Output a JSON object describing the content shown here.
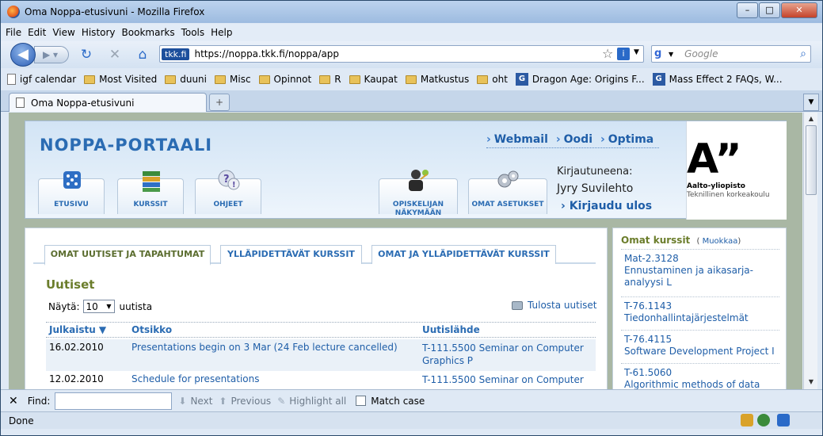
{
  "window": {
    "title": "Oma Noppa-etusivuni - Mozilla Firefox"
  },
  "menu": [
    "File",
    "Edit",
    "View",
    "History",
    "Bookmarks",
    "Tools",
    "Help"
  ],
  "nav": {
    "site_badge": "tkk.fi",
    "url": "https://noppa.tkk.fi/noppa/app",
    "search_placeholder": "Google"
  },
  "bookmarks": [
    {
      "label": "igf calendar",
      "icon": "page-icon"
    },
    {
      "label": "Most Visited",
      "icon": "folder-icon"
    },
    {
      "label": "duuni",
      "icon": "folder-icon"
    },
    {
      "label": "Misc",
      "icon": "folder-icon"
    },
    {
      "label": "Opinnot",
      "icon": "folder-icon"
    },
    {
      "label": "R",
      "icon": "folder-icon"
    },
    {
      "label": "Kaupat",
      "icon": "folder-icon"
    },
    {
      "label": "Matkustus",
      "icon": "folder-icon"
    },
    {
      "label": "oht",
      "icon": "folder-icon"
    },
    {
      "label": "Dragon Age: Origins F...",
      "icon": "gamefaqs-icon"
    },
    {
      "label": "Mass Effect 2 FAQs, W...",
      "icon": "gamefaqs-icon"
    }
  ],
  "tab": {
    "title": "Oma Noppa-etusivuni"
  },
  "portal": {
    "name": "NOPPA-PORTAALI",
    "nav_buttons": [
      {
        "label": "ETUSIVU",
        "icon": "dice-icon"
      },
      {
        "label": "KURSSIT",
        "icon": "books-icon"
      },
      {
        "label": "OHJEET",
        "icon": "help-icon"
      }
    ],
    "student_view": "OPISKELIJAN NÄKYMÄÄN",
    "own_settings": "OMAT ASETUKSET",
    "top_links": [
      "Webmail",
      "Oodi",
      "Optima"
    ],
    "logged_in_label": "Kirjautuneena:",
    "user_name": "Jyry Suvilehto",
    "logout": "Kirjaudu ulos",
    "logo_mark": "A”",
    "logo_line1": "Aalto-yliopisto",
    "logo_line2": "Teknillinen korkeakoulu"
  },
  "content_tabs": [
    "OMAT UUTISET JA TAPAHTUMAT",
    "YLLÄPIDETTÄVÄT KURSSIT",
    "OMAT JA YLLÄPIDETTÄVÄT KURSSIT"
  ],
  "news": {
    "title": "Uutiset",
    "show_label": "Näytä:",
    "show_value": "10",
    "show_suffix": "uutista",
    "print_label": "Tulosta uutiset",
    "columns": [
      "Julkaistu ▼",
      "Otsikko",
      "Uutislähde"
    ],
    "rows": [
      {
        "date": "16.02.2010",
        "title": "Presentations begin on 3 Mar (24 Feb lecture cancelled)",
        "source": "T-111.5500 Seminar on Computer Graphics P"
      },
      {
        "date": "12.02.2010",
        "title": "Schedule for presentations",
        "source": "T-111.5500 Seminar on Computer"
      }
    ]
  },
  "my_courses": {
    "title": "Omat kurssit",
    "edit_open": "(",
    "edit": "Muokkaa",
    "edit_close": ")",
    "items": [
      {
        "code": "Mat-2.3128",
        "name": "Ennustaminen ja aikasarja-analyysi L"
      },
      {
        "code": "T-76.1143",
        "name": "Tiedonhallintajärjestelmät"
      },
      {
        "code": "T-76.4115",
        "name": "Software Development Project I"
      },
      {
        "code": "T-61.5060",
        "name": "Algorithmic methods of data"
      }
    ]
  },
  "findbar": {
    "label": "Find:",
    "next": "Next",
    "previous": "Previous",
    "highlight": "Highlight all",
    "match_case": "Match case"
  },
  "status": {
    "text": "Done"
  }
}
